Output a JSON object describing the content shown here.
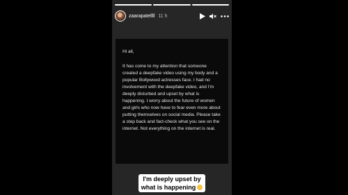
{
  "story": {
    "progress": [
      1,
      1,
      1
    ],
    "header": {
      "username": "zaarapatellll",
      "time_ago": "11 h"
    },
    "icons": {
      "play": "play-icon",
      "mute": "speaker-muted-icon",
      "more": "more-icon",
      "emoji": "disappointed-face-icon"
    },
    "note": {
      "greeting": "Hi all,",
      "body": "It has come to my attention that someone created a deepfake video using my body and a popular Bollywood actresses face. I had no involvement with the deepfake video, and I'm deeply disturbed and upset by what is happening. I worry about the future of women and girls who now have to fear even more about putting themselves on social media. Please take a step back and fact-check what you see on the internet. Not everything on the internet is real."
    },
    "caption": {
      "line1": "I'm deeply upset by",
      "line2": "what is happening"
    }
  }
}
